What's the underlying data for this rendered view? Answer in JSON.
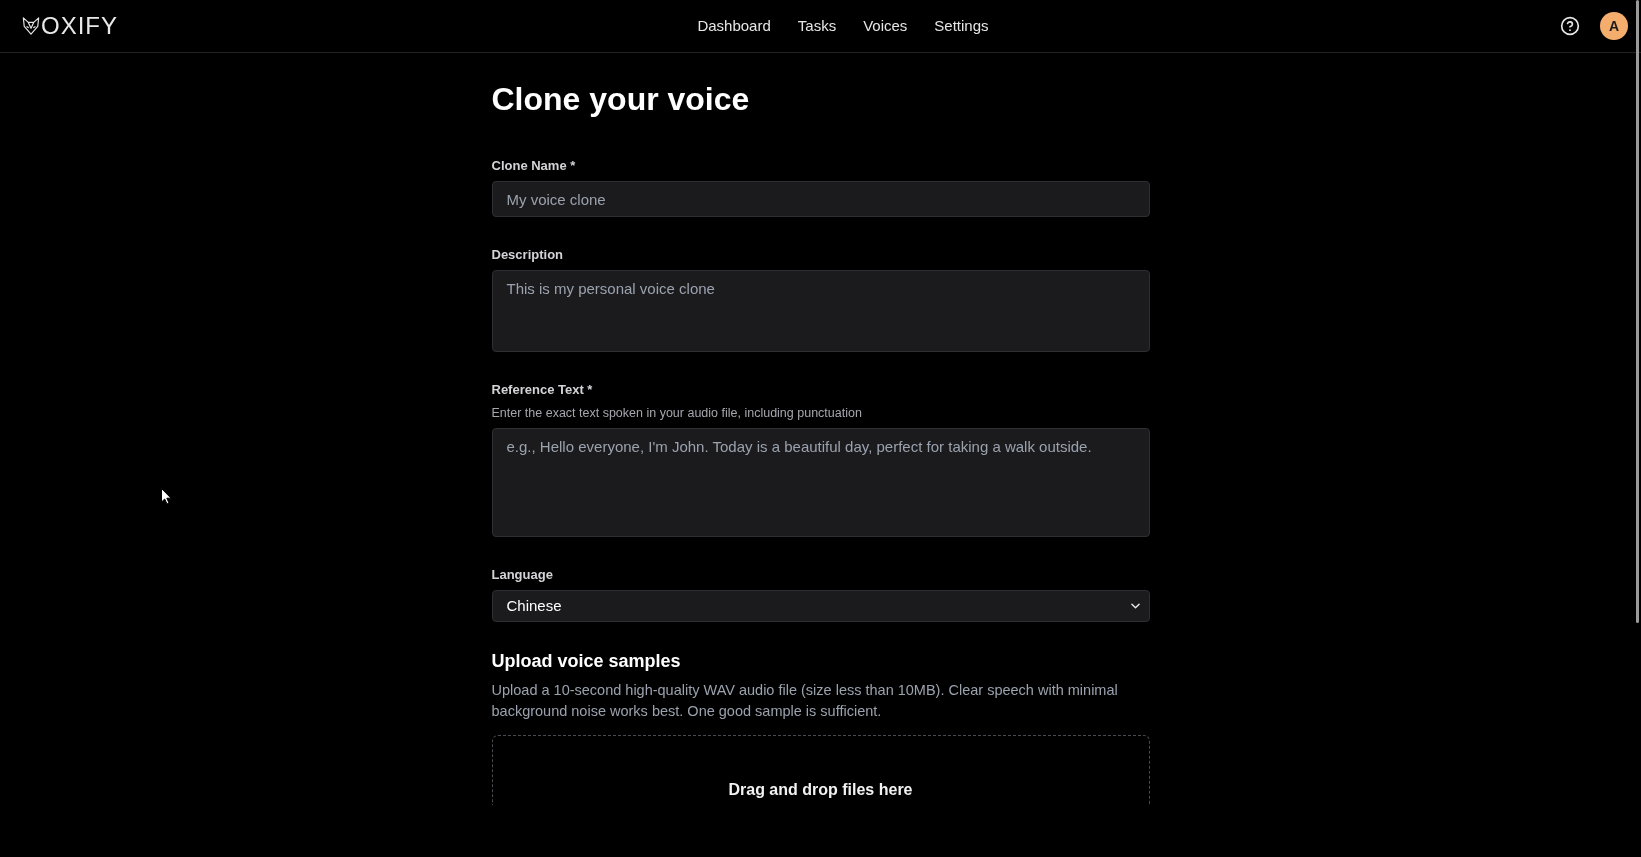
{
  "header": {
    "logo": {
      "text": "OXIFY"
    },
    "nav": [
      {
        "label": "Dashboard"
      },
      {
        "label": "Tasks"
      },
      {
        "label": "Voices"
      },
      {
        "label": "Settings"
      }
    ],
    "avatar": {
      "initial": "A"
    }
  },
  "page": {
    "title": "Clone your voice"
  },
  "form": {
    "fields": [
      {
        "kind": "input",
        "label": "Clone Name *",
        "placeholder": "My voice clone"
      },
      {
        "kind": "textarea",
        "label": "Description",
        "placeholder": "This is my personal voice clone"
      },
      {
        "kind": "textarea",
        "label": "Reference Text *",
        "hint": "Enter the exact text spoken in your audio file, including punctuation",
        "placeholder": "e.g., Hello everyone, I'm John. Today is a beautiful day, perfect for taking a walk outside."
      },
      {
        "kind": "select",
        "label": "Language",
        "value": "Chinese"
      }
    ]
  },
  "upload": {
    "title": "Upload voice samples",
    "description": "Upload a 10-second high-quality WAV audio file (size less than 10MB). Clear speech with minimal background noise works best. One good sample is sufficient.",
    "dropzone": {
      "text": "Drag and drop files here"
    }
  }
}
